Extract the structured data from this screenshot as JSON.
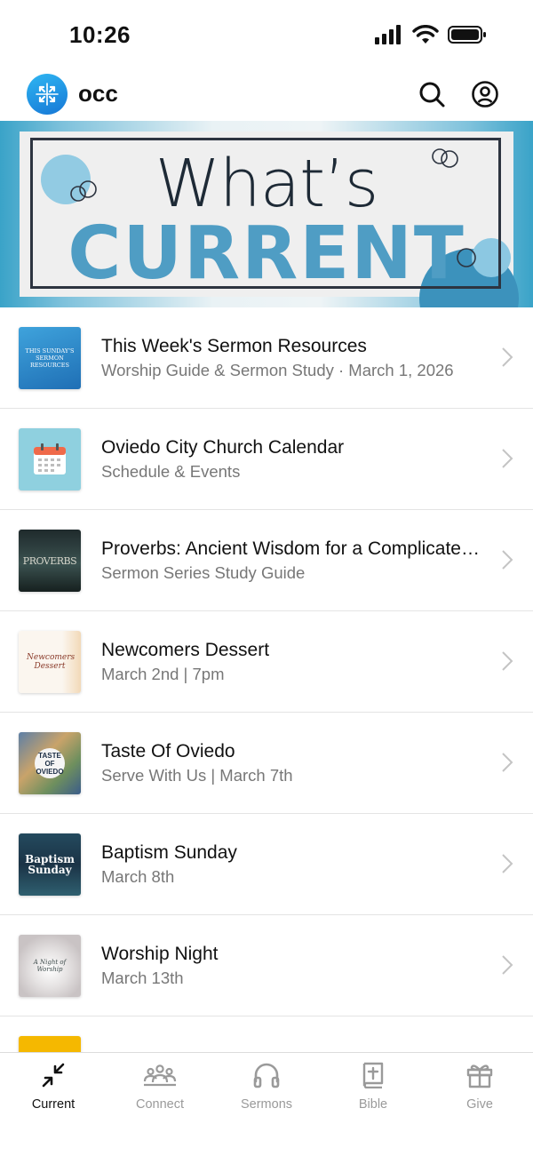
{
  "status": {
    "time": "10:26"
  },
  "header": {
    "app_name": "occ"
  },
  "banner": {
    "line1": "What’s",
    "line2": "CURRENT"
  },
  "items": [
    {
      "title": "This Week's Sermon Resources",
      "subtitle": "Worship Guide & Sermon Study · March 1, 2026",
      "thumb_text": "THIS SUNDAY'S SERMON RESOURCES"
    },
    {
      "title": "Oviedo City Church Calendar",
      "subtitle": "Schedule & Events"
    },
    {
      "title": "Proverbs: Ancient Wisdom for a Complicated World",
      "subtitle": "Sermon Series Study Guide",
      "thumb_text": "PROVERBS"
    },
    {
      "title": "Newcomers Dessert",
      "subtitle": "March 2nd | 7pm",
      "thumb_text": "Newcomers Dessert"
    },
    {
      "title": "Taste Of Oviedo",
      "subtitle": "Serve With Us | March 7th",
      "thumb_text": "TASTE OF OVIEDO"
    },
    {
      "title": "Baptism Sunday",
      "subtitle": "March 8th",
      "thumb_text": "Baptism Sunday"
    },
    {
      "title": "Worship Night",
      "subtitle": "March 13th",
      "thumb_text": "A Night of Worship"
    }
  ],
  "tabs": [
    {
      "label": "Current",
      "icon": "compress-arrows-icon",
      "active": true
    },
    {
      "label": "Connect",
      "icon": "group-icon"
    },
    {
      "label": "Sermons",
      "icon": "headphones-icon"
    },
    {
      "label": "Bible",
      "icon": "bible-icon"
    },
    {
      "label": "Give",
      "icon": "gift-icon"
    }
  ],
  "colors": {
    "accent_blue": "#4f9dc4",
    "logo_blue": "#1f8fe6",
    "text_muted": "#777777"
  }
}
